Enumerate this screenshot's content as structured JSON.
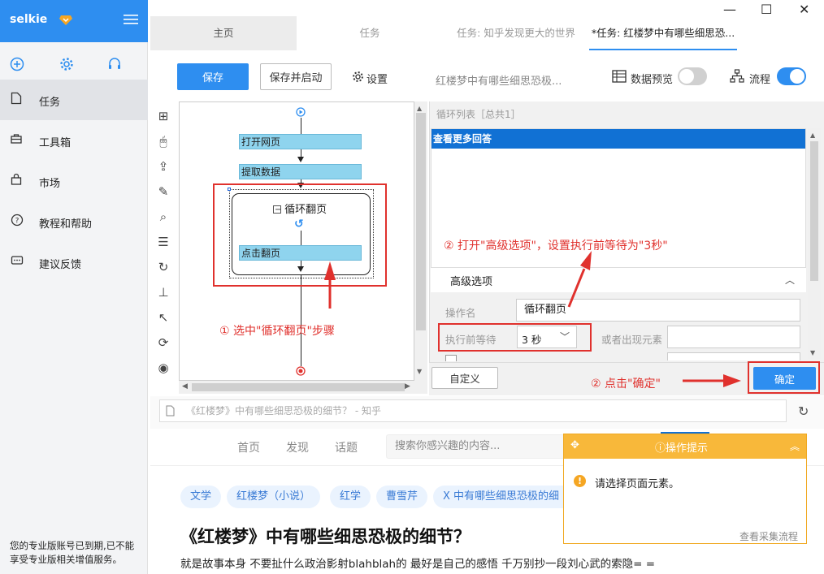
{
  "sidebar": {
    "brand": "selkie",
    "items": [
      {
        "label": "任务",
        "icon": "document-icon"
      },
      {
        "label": "工具箱",
        "icon": "toolbox-icon"
      },
      {
        "label": "市场",
        "icon": "bag-icon"
      },
      {
        "label": "教程和帮助",
        "icon": "help-icon"
      },
      {
        "label": "建议反馈",
        "icon": "feedback-icon"
      }
    ],
    "footer": "您的专业版账号已到期,已不能享受专业版相关增值服务。"
  },
  "tabs": [
    {
      "label": "主页"
    },
    {
      "label": "任务"
    },
    {
      "label": "任务: 知乎发现更大的世界"
    },
    {
      "label": "*任务: 红楼梦中有哪些细思恐..."
    }
  ],
  "toolbar": {
    "save": "保存",
    "save_start": "保存并启动",
    "settings": "设置",
    "task_title": "红楼梦中有哪些细思恐极...",
    "data_preview": "数据预览",
    "flow": "流程"
  },
  "workflow": {
    "open_page": "打开网页",
    "extract": "提取数据",
    "loop_title": "循环翻页",
    "click_page": "点击翻页"
  },
  "panel": {
    "loop_list_header": "循环列表［总共1］",
    "loop_item": "查看更多回答",
    "advanced_title": "高级选项",
    "op_name_label": "操作名",
    "op_name_value": "循环翻页",
    "wait_label": "执行前等待",
    "wait_value": "3 秒",
    "or_appear_label": "或者出现元素",
    "custom_btn": "自定义",
    "confirm_btn": "确定"
  },
  "annotations": {
    "step1": "① 选中\"循环翻页\"步骤",
    "step2a": "② 打开\"高级选项\"，设置执行前等待为\"3秒\"",
    "step2b": "② 点击\"确定\""
  },
  "browser": {
    "address": "《红楼梦》中有哪些细思恐极的细节？ - 知乎",
    "nav": [
      "首页",
      "发现",
      "话题"
    ],
    "search_placeholder": "搜索你感兴趣的内容...",
    "tags": [
      "文学",
      "红楼梦（小说）",
      "红学",
      "曹雪芹",
      "X 中有哪些细思恐极的细"
    ],
    "question": "《红楼梦》中有哪些细思恐极的细节？",
    "desc": "就是故事本身 不要扯什么政治影射blahblah的 最好是自己的感悟 千万别抄一段刘心武的索隐= ="
  },
  "tip": {
    "title": "操作提示",
    "message": "请选择页面元素。",
    "link": "查看采集流程"
  },
  "colors": {
    "accent": "#2e8ef0",
    "annotation": "#e0312d",
    "tip": "#f8b83a"
  }
}
